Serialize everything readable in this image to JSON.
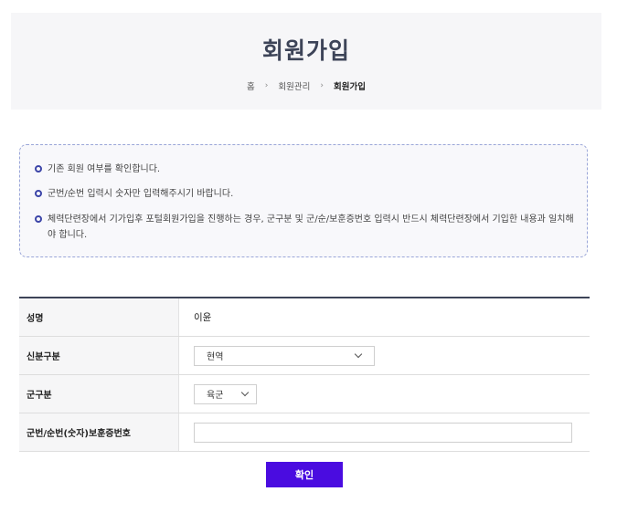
{
  "header": {
    "title": "회원가입",
    "breadcrumb": [
      "홈",
      "회원관리",
      "회원가입"
    ],
    "separator": "›"
  },
  "notice": {
    "items": [
      "기존 회원 여부를 확인합니다.",
      "군번/순번 입력시 숫자만 입력해주시기 바랍니다.",
      "체력단련장에서 기가입후 포털회원가입을 진행하는 경우, 군구분 및 군/순/보훈증번호 입력시 반드시 체력단련장에서 기입한 내용과 일치해야 합니다."
    ],
    "bullet_color": "#3c45a8"
  },
  "form": {
    "name_label": "성명",
    "name_value": "이윤",
    "status_label": "신분구분",
    "status_value": "현역",
    "branch_label": "군구분",
    "branch_value": "육군",
    "id_label": "군번/순번(숫자)보훈증번호",
    "id_value": ""
  },
  "actions": {
    "confirm_label": "확인",
    "confirm_color": "#4a0ce0"
  }
}
